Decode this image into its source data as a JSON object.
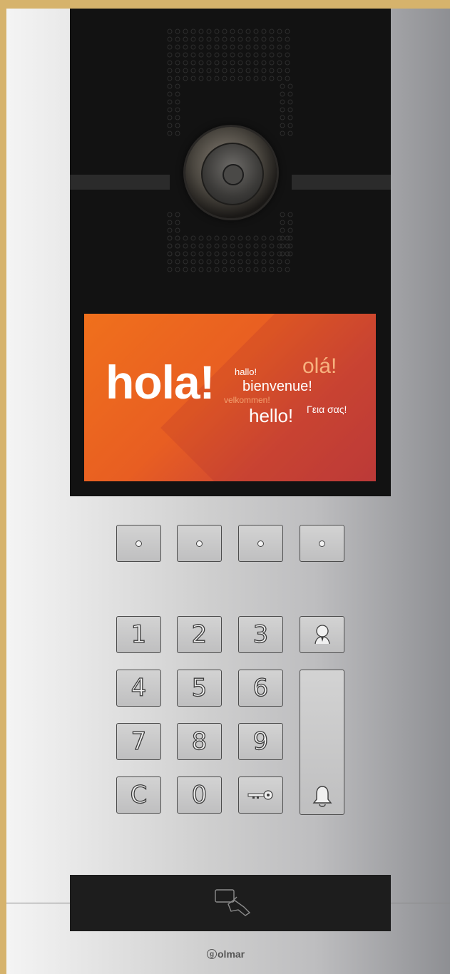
{
  "screen": {
    "greeting_main": "hola!",
    "greeting_hallo": "hallo!",
    "greeting_ola": "olá!",
    "greeting_bienvenue": "bienvenue!",
    "greeting_velkommen": "velkommen!",
    "greeting_hello": "hello!",
    "greeting_greek": "Γεια σας!"
  },
  "call_buttons": [
    {
      "name": "call-button-1",
      "icon": "dot-indicator"
    },
    {
      "name": "call-button-2",
      "icon": "dot-indicator"
    },
    {
      "name": "call-button-3",
      "icon": "dot-indicator"
    },
    {
      "name": "call-button-4",
      "icon": "dot-indicator"
    }
  ],
  "keypad": {
    "keys": [
      "1",
      "2",
      "3",
      "4",
      "5",
      "6",
      "7",
      "8",
      "9",
      "C",
      "0"
    ],
    "concierge_icon": "concierge-icon",
    "access_icon": "key-icon",
    "call_icon": "bell-icon"
  },
  "reader": {
    "icon": "proximity-card-icon"
  },
  "brand": {
    "logo_letter": "g",
    "name": "olmar"
  },
  "colors": {
    "frame": "#d6b36c",
    "panel_dark": "#121212",
    "screen_orange": "#f0701c",
    "screen_red": "#c23e3a"
  }
}
